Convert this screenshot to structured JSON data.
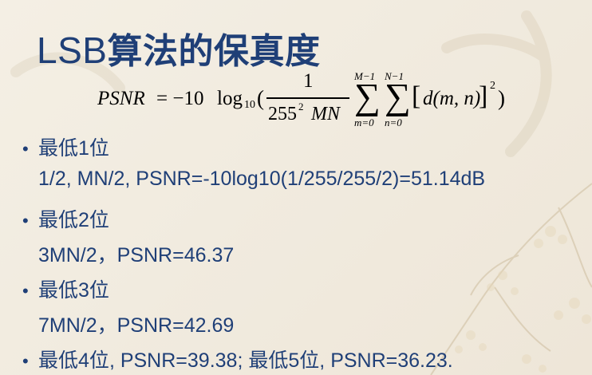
{
  "title": {
    "latin": "LSB",
    "chinese": "算法的保真度"
  },
  "formula": {
    "lhs": "PSNR",
    "equals_minus": "= −10",
    "log": "log",
    "log_base": "10",
    "open_paren": "(",
    "numerator": "1",
    "denominator_base": "255",
    "denominator_exp": "2",
    "denominator_tail": "MN",
    "sum1_upper": "M−1",
    "sum1_lower": "m=0",
    "sum2_upper": "N−1",
    "sum2_lower": "n=0",
    "sigma": "∑",
    "bracket_open": "[",
    "term": "d(m, n)",
    "bracket_close": "]",
    "square": "2",
    "close_paren": ")"
  },
  "bullets": [
    {
      "head_cn": "最低",
      "head_num": "1",
      "head_suffix": "位",
      "detail": "1/2, MN/2,  PSNR=-10log10(1/255/255/2)=51.14dB"
    },
    {
      "head_cn": "最低",
      "head_num": "2",
      "head_suffix": "位",
      "detail": "3MN/2，PSNR=46.37"
    },
    {
      "head_cn": "最低",
      "head_num": "3",
      "head_suffix": "位",
      "detail": "7MN/2，PSNR=42.69"
    }
  ],
  "last_line": {
    "a_cn": "最低",
    "a_num": "4",
    "a_suffix": "位",
    "a_text": ", PSNR=39.38;",
    "b_cn": "最低",
    "b_num": "5",
    "b_suffix": "位",
    "b_text": ", PSNR=36.23."
  },
  "bullet_symbol": "•",
  "colors": {
    "text_blue": "#1f3f77",
    "background": "#f1ebdf"
  }
}
